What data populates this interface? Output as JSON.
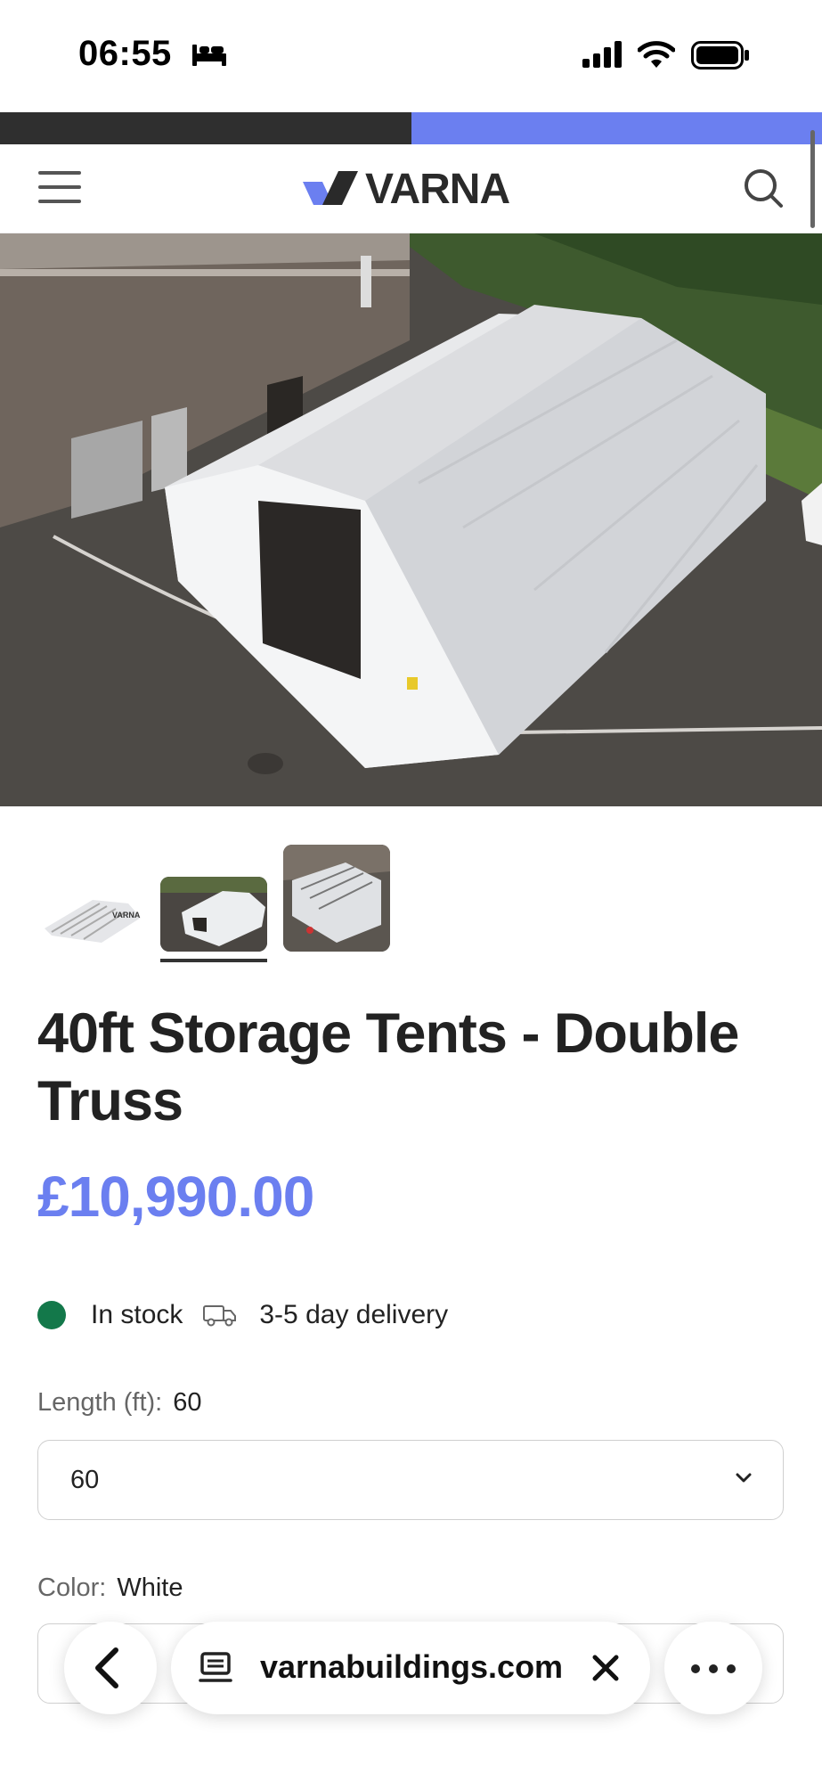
{
  "status_bar": {
    "time": "06:55"
  },
  "header": {
    "logo_text": "VARNA"
  },
  "product": {
    "title": "40ft Storage Tents - Double Truss",
    "price": "£10,990.00",
    "stock_status": "In stock",
    "delivery": "3-5 day delivery"
  },
  "options": {
    "length_label": "Length (ft):",
    "length_value": "60",
    "length_selected": "60",
    "color_label": "Color:",
    "color_value": "White"
  },
  "thumbnails": {
    "count": 3,
    "selected_index": 1
  },
  "browser": {
    "url": "varnabuildings.com"
  },
  "colors": {
    "accent": "#6b7ff0",
    "stock_green": "#13784a",
    "text": "#222222"
  },
  "icons": [
    "bed-icon",
    "signal-icon",
    "wifi-icon",
    "battery-icon",
    "menu-icon",
    "search-icon",
    "truck-icon",
    "chevron-down-icon",
    "back-icon",
    "tab-icon",
    "close-icon",
    "more-icon"
  ]
}
